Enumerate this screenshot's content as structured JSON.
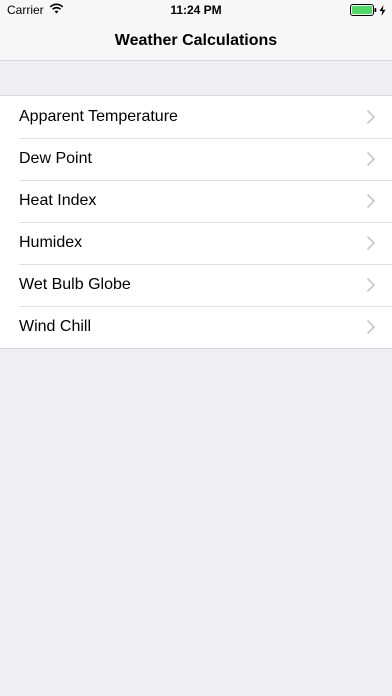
{
  "status_bar": {
    "carrier": "Carrier",
    "time": "11:24 PM"
  },
  "nav": {
    "title": "Weather Calculations"
  },
  "list": {
    "items": [
      {
        "label": "Apparent Temperature"
      },
      {
        "label": "Dew Point"
      },
      {
        "label": "Heat Index"
      },
      {
        "label": "Humidex"
      },
      {
        "label": "Wet Bulb Globe"
      },
      {
        "label": "Wind Chill"
      }
    ]
  },
  "colors": {
    "background": "#efeff4",
    "cell": "#ffffff",
    "separator": "#dedee2",
    "chevron": "#c7c7cc",
    "battery": "#4cd964"
  },
  "icons": {
    "wifi": "wifi-icon",
    "battery": "battery-icon",
    "charging": "charging-bolt-icon",
    "disclosure": "chevron-right-icon"
  }
}
